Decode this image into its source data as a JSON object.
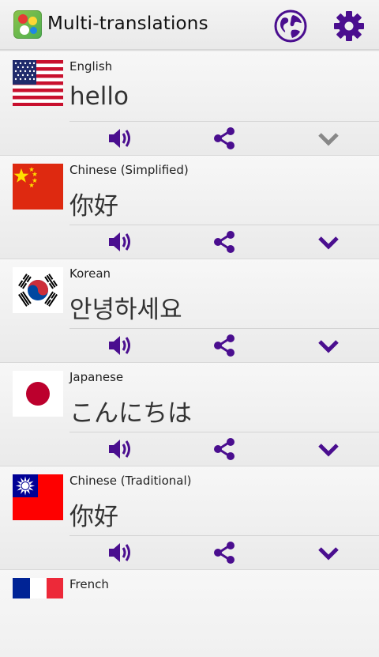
{
  "app": {
    "title": "Multi-translations",
    "accent_color": "#4a0e8f",
    "icons": {
      "app": "app-logo-icon",
      "globe": "globe-icon",
      "settings": "gear-icon",
      "speak": "speaker-icon",
      "share": "share-icon",
      "expand": "chevron-down-icon"
    }
  },
  "translations": [
    {
      "language": "English",
      "text": "hello",
      "flag": "us-flag-icon",
      "expand_active": false
    },
    {
      "language": "Chinese (Simplified)",
      "text": "你好",
      "flag": "china-flag-icon",
      "expand_active": true
    },
    {
      "language": "Korean",
      "text": "안녕하세요",
      "flag": "korea-flag-icon",
      "expand_active": true
    },
    {
      "language": "Japanese",
      "text": "こんにちは",
      "flag": "japan-flag-icon",
      "expand_active": true
    },
    {
      "language": "Chinese (Traditional)",
      "text": "你好",
      "flag": "taiwan-flag-icon",
      "expand_active": true
    },
    {
      "language": "French",
      "text": "",
      "flag": "france-flag-icon",
      "expand_active": true
    }
  ]
}
